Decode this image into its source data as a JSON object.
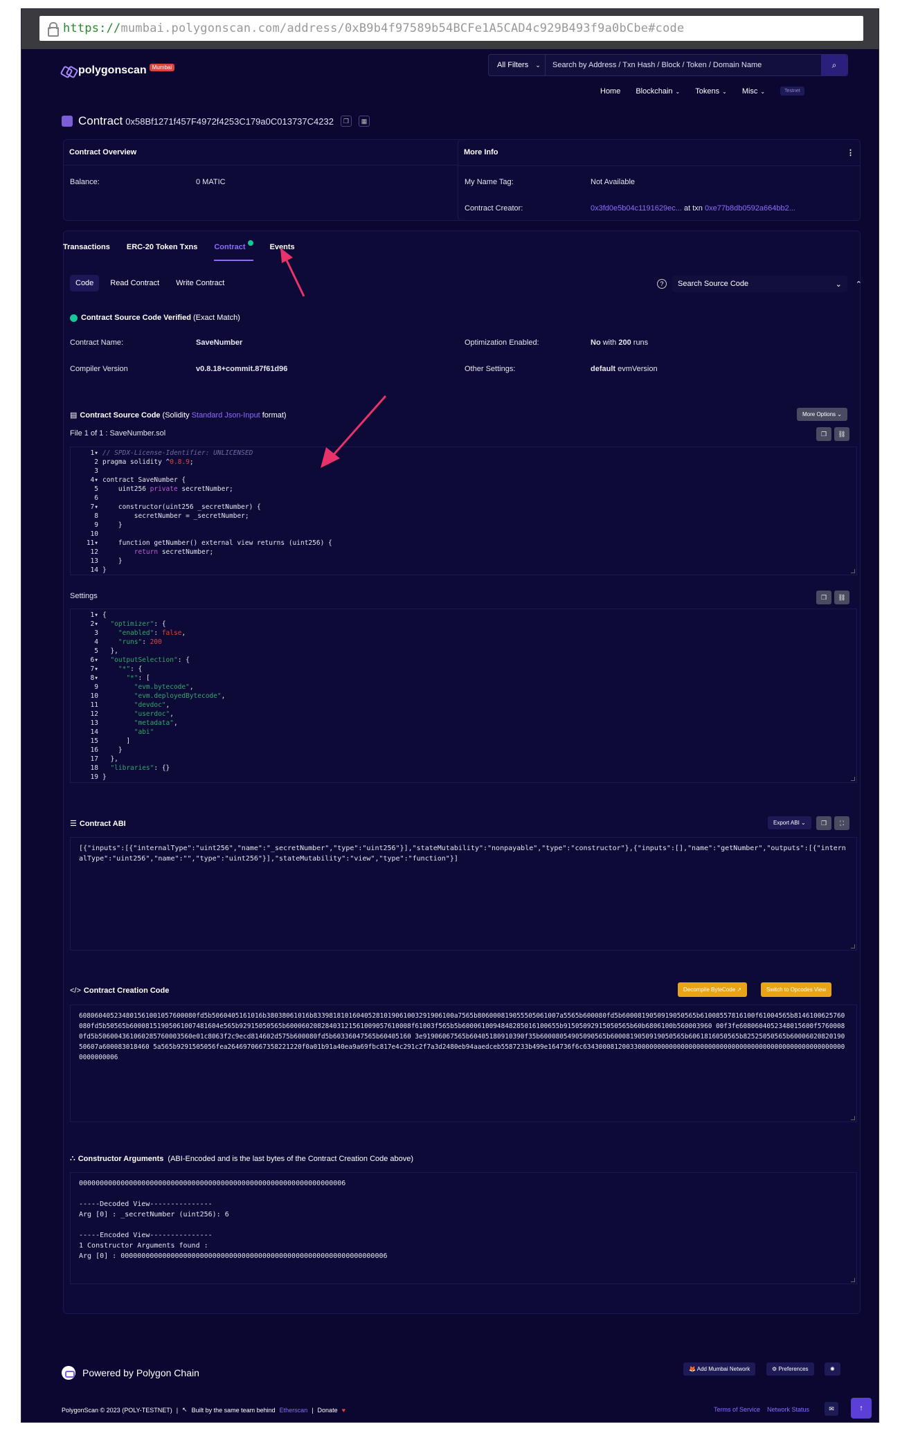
{
  "browser": {
    "url_scheme": "https://",
    "url_rest": "mumbai.polygonscan.com/address/0xB9b4f97589b54BCFe1A5CAD4c929B493f9a0bCbe#code"
  },
  "header": {
    "brand": "polygonscan",
    "network_badge": "Mumbai",
    "filter_label": "All Filters",
    "search_placeholder": "Search by Address / Txn Hash / Block / Token / Domain Name",
    "nav": [
      "Home",
      "Blockchain",
      "Tokens",
      "Misc"
    ],
    "testnet_label": "Testnet"
  },
  "title": {
    "label": "Contract",
    "address": "0x58Bf1271f457F4972f4253C179a0C013737C4232"
  },
  "overview": {
    "heading": "Contract Overview",
    "balance_label": "Balance:",
    "balance_value": "0 MATIC"
  },
  "more_info": {
    "heading": "More Info",
    "name_tag_label": "My Name Tag:",
    "name_tag_value": "Not Available",
    "creator_label": "Contract Creator:",
    "creator_address": "0x3fd0e5b04c1191629ec...",
    "at_txn": "at txn",
    "creator_txn": "0xe77b8db0592a664bb2..."
  },
  "tabs": [
    "Transactions",
    "ERC-20 Token Txns",
    "Contract",
    "Events"
  ],
  "subtabs": [
    "Code",
    "Read Contract",
    "Write Contract"
  ],
  "source_search_placeholder": "Search Source Code",
  "verification": {
    "strong": "Contract Source Code Verified",
    "note": "(Exact Match)"
  },
  "contract_info": {
    "name_label": "Contract Name:",
    "name_value": "SaveNumber",
    "compiler_label": "Compiler Version",
    "compiler_value": "v0.8.18+commit.87f61d96",
    "optimization_label": "Optimization Enabled:",
    "optimization_value_strong": "No",
    "optimization_value_rest": "with",
    "optimization_runs": "200",
    "optimization_runs_suffix": "runs",
    "other_label": "Other Settings:",
    "other_value_strong": "default",
    "other_value_rest": "evmVersion"
  },
  "source_code": {
    "heading": "Contract Source Code",
    "lang_prefix": "(Solidity",
    "lang_link": "Standard Json-Input",
    "lang_suffix": "format)",
    "more_options": "More Options",
    "file_label": "File 1 of 1 : SaveNumber.sol"
  },
  "settings_label": "Settings",
  "abi": {
    "heading": "Contract ABI",
    "export_label": "Export ABI",
    "text": "[{\"inputs\":[{\"internalType\":\"uint256\",\"name\":\"_secretNumber\",\"type\":\"uint256\"}],\"stateMutability\":\"nonpayable\",\"type\":\"constructor\"},{\"inputs\":[],\"name\":\"getNumber\",\"outputs\":[{\"internalType\":\"uint256\",\"name\":\"\",\"type\":\"uint256\"}],\"stateMutability\":\"view\",\"type\":\"function\"}]"
  },
  "creation_code": {
    "heading": "Contract Creation Code",
    "decompile_label": "Decompile ByteCode",
    "opcodes_label": "Switch to Opcodes View",
    "text": "608060405234801561001057600080fd5b5060405161016b38038061016b833981810160405281019061003291906100a7565b806000819055505061007a5565b600080fd5b6000819050919050565b61008557816100f61004565b8146100625760080fd5b50565b60008151905061007481604e565b92915050565b60006020828403121561009057610008f61003f565b5b6000610094848285016100655b91505092915050565b60b6806100b560003960 00f3fe6080604052348015600f57600080fd5b506004361060285760003560e01c8063f2c9ecd814602d575b600080fd5b60336047565b60405160 3e91906067565b60405180910390f35b60008054905090565b6000819050919050565b6061816050565b82525050565b6000602082019050607a600083018460 5a565b9291505056fea2646970667358221220f0a01b91a40ea9a69fbc817e4c291c2f7a3d2480eb94aaedceb5587233b499e164736f6c63430008120033000000000000000000000000000000000000000000000000000000000000006"
  },
  "constructor_args": {
    "heading": "Constructor Arguments",
    "note": "(ABI-Encoded and is the last bytes of the Contract Creation Code above)",
    "lines": [
      "0000000000000000000000000000000000000000000000000000000000000006",
      "",
      "-----Decoded View---------------",
      "Arg [0] : _secretNumber (uint256): 6",
      "",
      "-----Encoded View---------------",
      "1 Constructor Arguments found :",
      "Arg [0] : 0000000000000000000000000000000000000000000000000000000000000006"
    ]
  },
  "footer": {
    "powered": "Powered by Polygon Chain",
    "add_network": "Add Mumbai Network",
    "preferences": "Preferences",
    "copyright": "PolygonScan © 2023 (POLY-TESTNET)",
    "built_by": "Built by the same team behind",
    "etherscan": "Etherscan",
    "donate": "Donate",
    "terms": "Terms of Service",
    "network_status": "Network Status"
  }
}
